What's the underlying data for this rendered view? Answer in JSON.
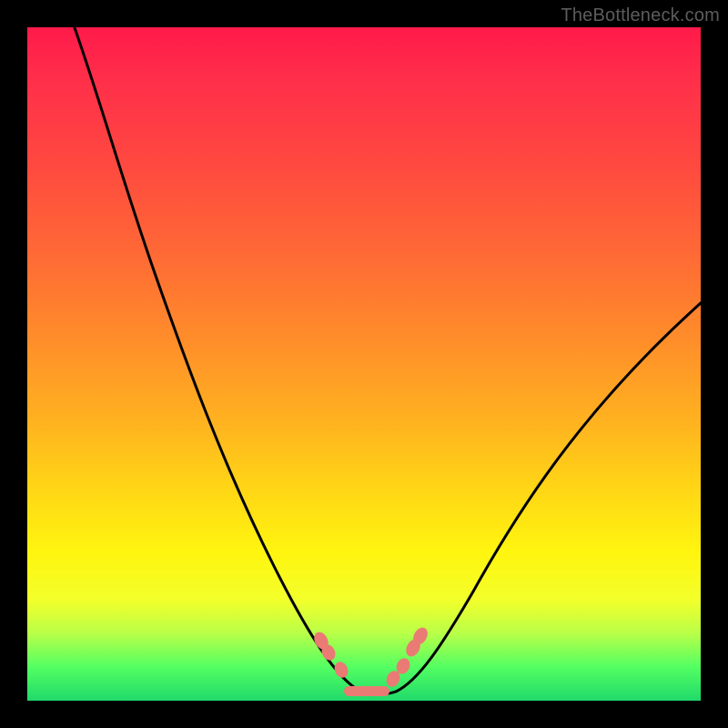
{
  "attribution": "TheBottleneck.com",
  "colors": {
    "frame": "#000000",
    "gradient_top": "#ff1a4a",
    "gradient_bottom": "#20d96a",
    "curve": "#000000",
    "trough_marker": "#ea7a74",
    "attribution_text": "#5c5c5c"
  },
  "chart_data": {
    "type": "line",
    "title": "",
    "xlabel": "",
    "ylabel": "",
    "xlim": [
      0,
      100
    ],
    "ylim": [
      0,
      100
    ],
    "grid": false,
    "legend": false,
    "series": [
      {
        "name": "bottleneck-curve",
        "x": [
          7,
          10,
          14,
          18,
          22,
          26,
          30,
          34,
          38,
          42,
          46,
          49,
          51,
          53,
          56,
          60,
          65,
          70,
          76,
          82,
          88,
          94,
          100
        ],
        "values": [
          100,
          90,
          79,
          68,
          58,
          48,
          39,
          30,
          22,
          15,
          8,
          3,
          1,
          1,
          2,
          5,
          10,
          17,
          25,
          33,
          42,
          51,
          59
        ]
      }
    ],
    "annotations": [
      {
        "type": "trough-markers",
        "x": [
          43.5,
          44.5,
          46.5,
          54.0,
          55.5,
          57.0,
          58.0
        ],
        "values": [
          9.0,
          7.5,
          4.8,
          3.0,
          5.0,
          8.0,
          9.5
        ]
      },
      {
        "type": "trough-band",
        "x_start": 47.0,
        "x_end": 53.5,
        "y": 1.5
      }
    ]
  }
}
